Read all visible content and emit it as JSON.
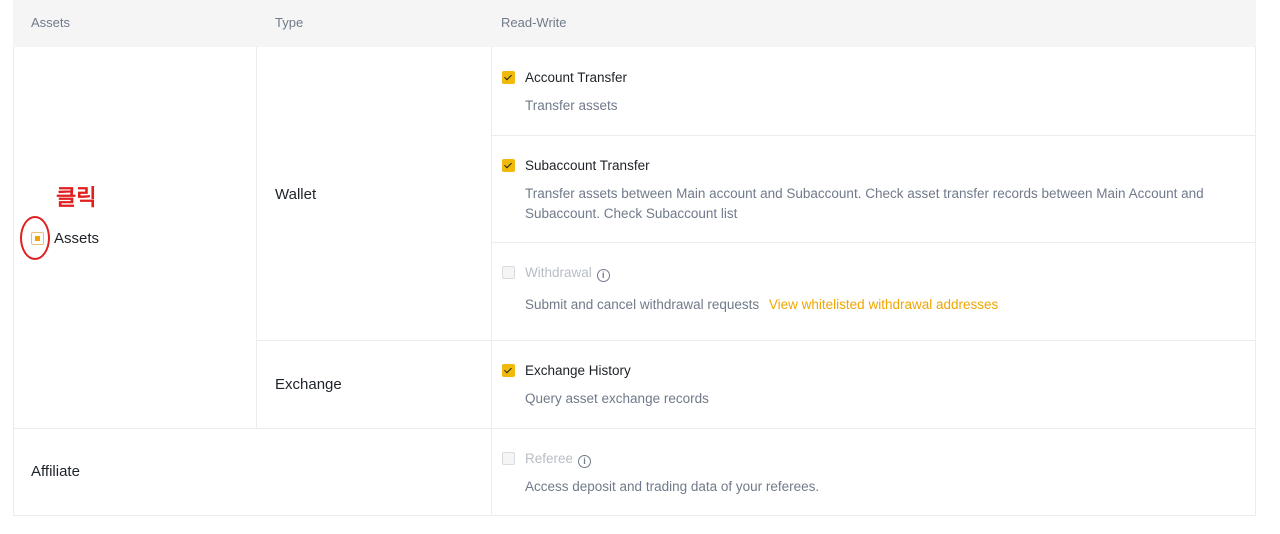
{
  "header": {
    "col_assets": "Assets",
    "col_type": "Type",
    "col_readwrite": "Read-Write"
  },
  "groups": {
    "assets": {
      "label": "Assets",
      "annotation": "클릭"
    },
    "wallet": {
      "label": "Wallet"
    },
    "exchange": {
      "label": "Exchange"
    },
    "affiliate": {
      "label": "Affiliate"
    }
  },
  "permissions": {
    "account_transfer": {
      "title": "Account Transfer",
      "desc": "Transfer assets",
      "checked": true
    },
    "subaccount_transfer": {
      "title": "Subaccount Transfer",
      "desc_line1": "Transfer assets between Main account and Subaccount. Check asset transfer records between Main Account and",
      "desc_line2": "Subaccount. Check Subaccount list",
      "checked": true
    },
    "withdrawal": {
      "title": "Withdrawal",
      "desc": "Submit and cancel withdrawal requests",
      "link": "View whitelisted withdrawal addresses",
      "checked": false,
      "disabled": true
    },
    "exchange_history": {
      "title": "Exchange History",
      "desc": "Query asset exchange records",
      "checked": true
    },
    "referee": {
      "title": "Referee",
      "desc": "Access deposit and trading data of your referees.",
      "checked": false,
      "disabled": true
    }
  },
  "colors": {
    "accent": "#f0b90b",
    "link": "#f0a600",
    "annotation": "#e02020"
  }
}
